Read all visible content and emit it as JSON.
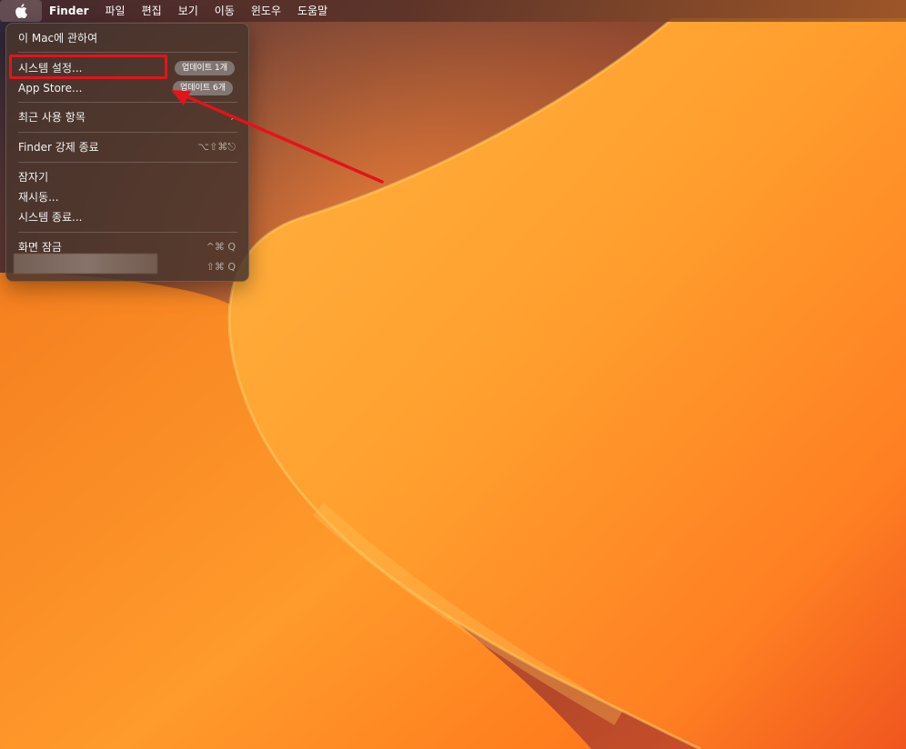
{
  "menubar": {
    "apple_icon": "apple-logo-icon",
    "app_name": "Finder",
    "menus": [
      "파일",
      "편집",
      "보기",
      "이동",
      "윈도우",
      "도움말"
    ]
  },
  "apple_menu": {
    "about": "이 Mac에 관하여",
    "system_settings": "시스템 설정...",
    "system_settings_badge": "업데이트 1개",
    "app_store": "App Store...",
    "app_store_badge": "업데이트 6개",
    "recent_items": "최근 사용 항목",
    "force_quit": "Finder 강제 종료",
    "force_quit_shortcut": "⌥⇧⌘⎋",
    "sleep": "잠자기",
    "restart": "재시동...",
    "shutdown": "시스템 종료...",
    "lock_screen": "화면 잠금",
    "lock_screen_shortcut": "^⌘ Q",
    "logout_shortcut": "⇧⌘ Q"
  },
  "colors": {
    "annotation_red": "#e3131b",
    "wallpaper_orange": "#f58a1e"
  }
}
